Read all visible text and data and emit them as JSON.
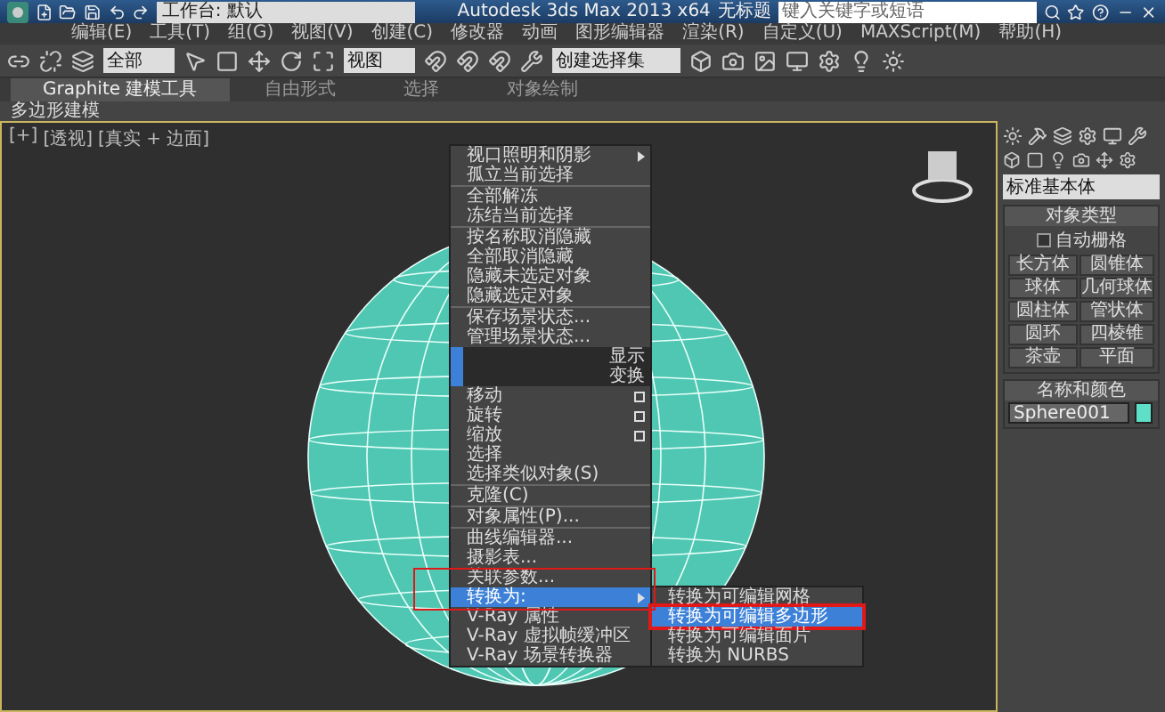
{
  "title_bar": {
    "workspace": "工作台: 默认",
    "title": "Autodesk 3ds Max  2013 x64",
    "file": "无标题",
    "search": {
      "placeholder": "键入关键字或短语"
    }
  },
  "menu_bar": [
    "编辑(E)",
    "工具(T)",
    "组(G)",
    "视图(V)",
    "创建(C)",
    "修改器",
    "动画",
    "图形编辑器",
    "渲染(R)",
    "自定义(U)",
    "MAXScript(M)",
    "帮助(H)"
  ],
  "toolbar": {
    "filter": "全部",
    "coord": "视图",
    "selection_set": "创建选择集"
  },
  "ribbon": {
    "tabs": [
      {
        "label": "Graphite 建模工具",
        "selected": true
      },
      {
        "label": "自由形式",
        "selected": false
      },
      {
        "label": "选择",
        "selected": false
      },
      {
        "label": "对象绘制",
        "selected": false
      }
    ],
    "panel": "多边形建模"
  },
  "viewport": {
    "labels": [
      "[+]",
      "[透视]",
      "[真实 + 边面]"
    ]
  },
  "context_menu": {
    "items": [
      {
        "kind": "item",
        "label": "视口照明和阴影",
        "submenu": true,
        "options": false,
        "selected": false
      },
      {
        "kind": "item",
        "label": "孤立当前选择",
        "submenu": false,
        "options": false,
        "selected": false
      },
      {
        "kind": "separator"
      },
      {
        "kind": "item",
        "label": "全部解冻",
        "submenu": false,
        "options": false,
        "selected": false
      },
      {
        "kind": "item",
        "label": "冻结当前选择",
        "submenu": false,
        "options": false,
        "selected": false
      },
      {
        "kind": "separator"
      },
      {
        "kind": "item",
        "label": "按名称取消隐藏",
        "submenu": false,
        "options": false,
        "selected": false
      },
      {
        "kind": "item",
        "label": "全部取消隐藏",
        "submenu": false,
        "options": false,
        "selected": false
      },
      {
        "kind": "item",
        "label": "隐藏未选定对象",
        "submenu": false,
        "options": false,
        "selected": false
      },
      {
        "kind": "item",
        "label": "隐藏选定对象",
        "submenu": false,
        "options": false,
        "selected": false
      },
      {
        "kind": "separator"
      },
      {
        "kind": "item",
        "label": "保存场景状态...",
        "submenu": false,
        "options": false,
        "selected": false
      },
      {
        "kind": "item",
        "label": "管理场景状态...",
        "submenu": false,
        "options": false,
        "selected": false
      },
      {
        "kind": "header",
        "label": "显示"
      },
      {
        "kind": "header",
        "label": "变换"
      },
      {
        "kind": "item",
        "label": "移动",
        "submenu": false,
        "options": true,
        "selected": false
      },
      {
        "kind": "item",
        "label": "旋转",
        "submenu": false,
        "options": true,
        "selected": false
      },
      {
        "kind": "item",
        "label": "缩放",
        "submenu": false,
        "options": true,
        "selected": false
      },
      {
        "kind": "item",
        "label": "选择",
        "submenu": false,
        "options": false,
        "selected": false
      },
      {
        "kind": "item",
        "label": "选择类似对象(S)",
        "submenu": false,
        "options": false,
        "selected": false
      },
      {
        "kind": "separator"
      },
      {
        "kind": "item",
        "label": "克隆(C)",
        "submenu": false,
        "options": false,
        "selected": false
      },
      {
        "kind": "separator"
      },
      {
        "kind": "item",
        "label": "对象属性(P)...",
        "submenu": false,
        "options": false,
        "selected": false
      },
      {
        "kind": "separator"
      },
      {
        "kind": "item",
        "label": "曲线编辑器...",
        "submenu": false,
        "options": false,
        "selected": false
      },
      {
        "kind": "item",
        "label": "摄影表...",
        "submenu": false,
        "options": false,
        "selected": false
      },
      {
        "kind": "item",
        "label": "关联参数...",
        "submenu": false,
        "options": false,
        "selected": false
      },
      {
        "kind": "item",
        "label": "转换为:",
        "submenu": true,
        "options": false,
        "selected": true
      },
      {
        "kind": "item",
        "label": "V-Ray 属性",
        "submenu": false,
        "options": false,
        "selected": false
      },
      {
        "kind": "item",
        "label": "V-Ray 虚拟帧缓冲区",
        "submenu": false,
        "options": false,
        "selected": false
      },
      {
        "kind": "item",
        "label": "V-Ray 场景转换器",
        "submenu": false,
        "options": false,
        "selected": false
      }
    ]
  },
  "submenu": {
    "items": [
      {
        "label": "转换为可编辑网格",
        "selected": false
      },
      {
        "label": "转换为可编辑多边形",
        "selected": true
      },
      {
        "label": "转换为可编辑面片",
        "selected": false
      },
      {
        "label": "转换为 NURBS",
        "selected": false
      }
    ]
  },
  "command_panel": {
    "dropdown": "标准基本体",
    "object_type": {
      "title": "对象类型",
      "autogrid": {
        "label": "自动栅格",
        "checked": false
      },
      "buttons": [
        "长方体",
        "圆锥体",
        "球体",
        "几何球体",
        "圆柱体",
        "管状体",
        "圆环",
        "四棱锥",
        "茶壶",
        "平面"
      ]
    },
    "name_color": {
      "title": "名称和颜色",
      "name": "Sphere001",
      "color": "#5ee0c8"
    }
  }
}
